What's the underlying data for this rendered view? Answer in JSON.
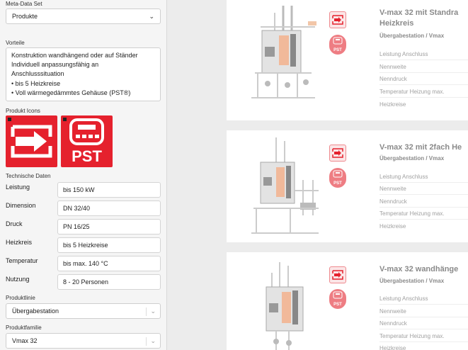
{
  "left": {
    "meta_label": "Meta-Data Set",
    "meta_value": "Produkte",
    "vorteile_label": "Vorteile",
    "vorteile_lines": [
      "Konstruktion wandhängend oder auf Ständer",
      "Individuell anpassungsfähig an",
      "Anschlusssituation",
      "• bis 5 Heizkreise",
      "• Voll wärmegedämmtes Gehäuse (PST®)"
    ],
    "icons_label": "Produkt Icons",
    "pst_text": "PST",
    "tech_label": "Technische Daten",
    "rows": [
      {
        "label": "Leistung",
        "value": "bis 150 kW"
      },
      {
        "label": "Dimension",
        "value": "DN 32/40"
      },
      {
        "label": "Druck",
        "value": "PN 16/25"
      },
      {
        "label": "Heizkreis",
        "value": "bis 5 Heizkreise"
      },
      {
        "label": "Temperatur",
        "value": "bis max. 140 °C"
      },
      {
        "label": "Nutzung",
        "value": "8 - 20 Personen"
      }
    ],
    "linie_label": "Produktlinie",
    "linie_value": "Übergabestation",
    "familie_label": "Produktfamilie",
    "familie_value": "Vmax 32"
  },
  "cards": [
    {
      "title_lines": [
        "V-max 32 mit Standra",
        "Heizkreis"
      ],
      "subtitle": "Übergabestation / Vmax",
      "specs": [
        "Leistung Anschluss",
        "Nennweite",
        "Nenndruck",
        "Temperatur Heizung max.",
        "Heizkreise"
      ],
      "pst": "PST"
    },
    {
      "title_lines": [
        "V-max 32 mit 2fach He"
      ],
      "subtitle": "Übergabestation / Vmax",
      "specs": [
        "Leistung Anschluss",
        "Nennweite",
        "Nenndruck",
        "Temperatur Heizung max.",
        "Heizkreise"
      ],
      "pst": "PST"
    },
    {
      "title_lines": [
        "V-max 32 wandhänge"
      ],
      "subtitle": "Übergabestation / Vmax",
      "specs": [
        "Leistung Anschluss",
        "Nennweite",
        "Nenndruck",
        "Temperatur Heizung max.",
        "Heizkreise"
      ],
      "pst": "PST"
    }
  ],
  "colors": {
    "brand_red": "#e5212d",
    "faded_red": "#ee7d83"
  }
}
